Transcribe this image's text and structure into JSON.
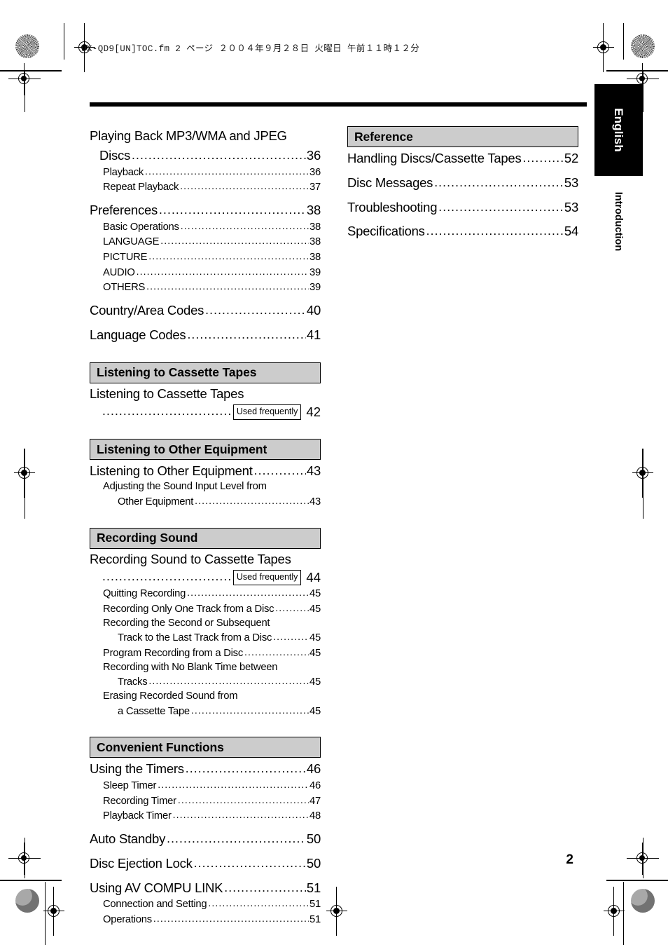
{
  "document": {
    "slug": "UX-QD9[UN]TOC.fm  2 ページ  ２００４年９月２８日  火曜日  午前１１時１２分",
    "page_number": "2",
    "side_tab": "English",
    "side_tab_sub": "Introduction"
  },
  "badges": {
    "used_frequently": "Used frequently"
  },
  "toc": {
    "left_column": [
      {
        "type": "entry",
        "level": 1,
        "lines": [
          {
            "text": "Playing Back MP3/WMA and JPEG",
            "dots": false,
            "page": ""
          },
          {
            "text": "Discs",
            "dots": true,
            "page": "36",
            "indent": 1
          }
        ]
      },
      {
        "type": "entry",
        "level": 2,
        "text": "Playback",
        "page": "36"
      },
      {
        "type": "entry",
        "level": 2,
        "text": "Repeat Playback",
        "page": "37"
      },
      {
        "type": "entry",
        "level": 1,
        "text": "Preferences",
        "page": "38"
      },
      {
        "type": "entry",
        "level": 2,
        "text": "Basic Operations",
        "page": "38"
      },
      {
        "type": "entry",
        "level": 2,
        "text": "LANGUAGE",
        "page": "38"
      },
      {
        "type": "entry",
        "level": 2,
        "text": "PICTURE",
        "page": "38"
      },
      {
        "type": "entry",
        "level": 2,
        "text": "AUDIO",
        "page": "39"
      },
      {
        "type": "entry",
        "level": 2,
        "text": "OTHERS",
        "page": "39"
      },
      {
        "type": "entry",
        "level": 1,
        "text": "Country/Area Codes",
        "page": "40"
      },
      {
        "type": "entry",
        "level": 1,
        "text": "Language Codes",
        "page": "41"
      },
      {
        "type": "section",
        "title": "Listening to Cassette Tapes"
      },
      {
        "type": "entry",
        "level": 1,
        "text": "Listening to Cassette Tapes",
        "page": "",
        "dots": false
      },
      {
        "type": "badge_row",
        "badge": "Used frequently",
        "page": "42"
      },
      {
        "type": "section",
        "title": "Listening to Other Equipment"
      },
      {
        "type": "entry",
        "level": 1,
        "text": "Listening to Other Equipment",
        "page": "43"
      },
      {
        "type": "entry",
        "level": 2,
        "text": "Adjusting the Sound Input Level from",
        "page": "",
        "dots": false
      },
      {
        "type": "entry",
        "level": 3,
        "text": "Other Equipment",
        "page": "43"
      },
      {
        "type": "section",
        "title": "Recording Sound"
      },
      {
        "type": "entry",
        "level": 1,
        "text": "Recording Sound to Cassette Tapes",
        "page": "",
        "dots": false
      },
      {
        "type": "badge_row",
        "badge": "Used frequently",
        "page": "44"
      },
      {
        "type": "entry",
        "level": 2,
        "text": "Quitting Recording",
        "page": "45"
      },
      {
        "type": "entry",
        "level": 2,
        "text": "Recording Only One Track from a Disc",
        "page": "45"
      },
      {
        "type": "entry",
        "level": 2,
        "text": "Recording the Second or Subsequent",
        "page": "",
        "dots": false
      },
      {
        "type": "entry",
        "level": 3,
        "text": "Track to the Last Track from a Disc",
        "page": "45"
      },
      {
        "type": "entry",
        "level": 2,
        "text": "Program Recording from a Disc",
        "page": "45"
      },
      {
        "type": "entry",
        "level": 2,
        "text": "Recording with No Blank Time between",
        "page": "",
        "dots": false
      },
      {
        "type": "entry",
        "level": 3,
        "text": "Tracks",
        "page": "45"
      },
      {
        "type": "entry",
        "level": 2,
        "text": "Erasing Recorded Sound from",
        "page": "",
        "dots": false
      },
      {
        "type": "entry",
        "level": 3,
        "text": "a Cassette Tape",
        "page": "45"
      },
      {
        "type": "section",
        "title": "Convenient Functions"
      },
      {
        "type": "entry",
        "level": 1,
        "text": "Using the Timers",
        "page": "46"
      },
      {
        "type": "entry",
        "level": 2,
        "text": "Sleep Timer",
        "page": "46"
      },
      {
        "type": "entry",
        "level": 2,
        "text": "Recording Timer",
        "page": "47"
      },
      {
        "type": "entry",
        "level": 2,
        "text": "Playback Timer",
        "page": "48"
      },
      {
        "type": "entry",
        "level": 1,
        "text": "Auto Standby",
        "page": "50"
      },
      {
        "type": "entry",
        "level": 1,
        "text": "Disc Ejection Lock",
        "page": "50"
      },
      {
        "type": "entry",
        "level": 1,
        "text": "Using AV COMPU LINK",
        "page": "51"
      },
      {
        "type": "entry",
        "level": 2,
        "text": "Connection and Setting",
        "page": "51"
      },
      {
        "type": "entry",
        "level": 2,
        "text": "Operations",
        "page": "51"
      }
    ],
    "right_column": [
      {
        "type": "section",
        "title": "Reference"
      },
      {
        "type": "entry",
        "level": 1,
        "text": "Handling Discs/Cassette Tapes",
        "page": "52"
      },
      {
        "type": "entry",
        "level": 1,
        "text": "Disc Messages",
        "page": "53"
      },
      {
        "type": "entry",
        "level": 1,
        "text": "Troubleshooting",
        "page": "53"
      },
      {
        "type": "entry",
        "level": 1,
        "text": "Specifications",
        "page": "54"
      }
    ]
  },
  "colors": {
    "section_bar_fill": "#cccccc",
    "rule": "#000000",
    "tab_fill": "#000000",
    "tab_text": "#ffffff"
  }
}
